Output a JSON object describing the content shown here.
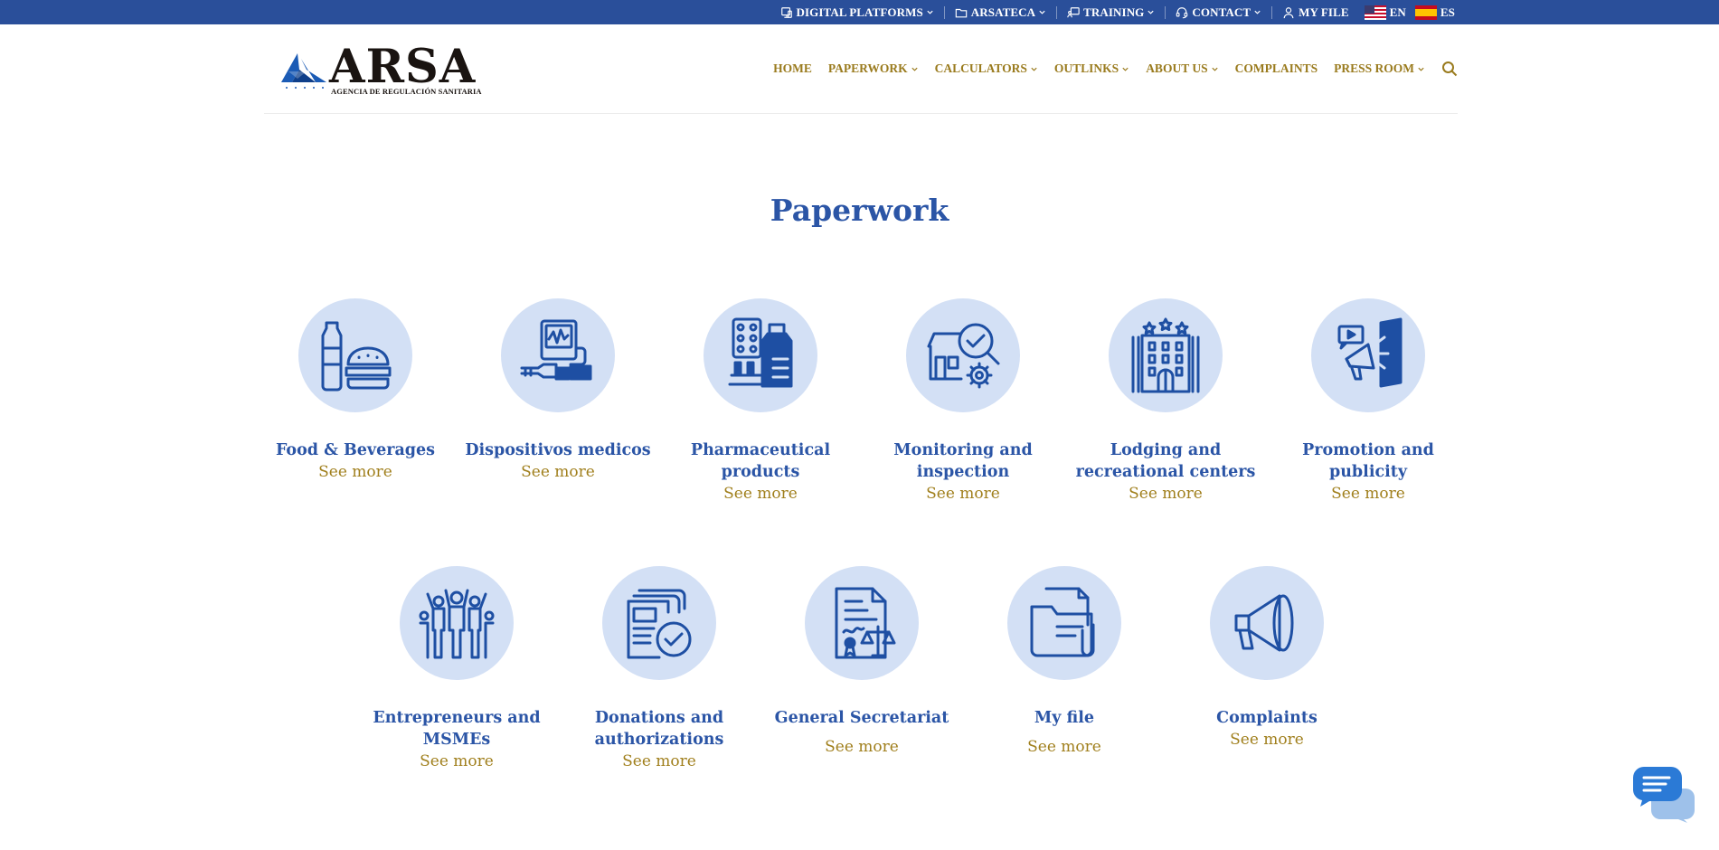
{
  "topbar": {
    "items": [
      {
        "label": "DIGITAL PLATFORMS"
      },
      {
        "label": "ARSATECA"
      },
      {
        "label": "TRAINING"
      },
      {
        "label": "CONTACT"
      },
      {
        "label": "MY FILE"
      }
    ],
    "lang_en": "EN",
    "lang_es": "ES"
  },
  "logo": {
    "word": "ARSA",
    "subtitle": "AGENCIA DE REGULACIÓN SANITARIA"
  },
  "nav": {
    "items": [
      {
        "label": "HOME"
      },
      {
        "label": "PAPERWORK"
      },
      {
        "label": "CALCULATORS"
      },
      {
        "label": "OUTLINKS"
      },
      {
        "label": "ABOUT US"
      },
      {
        "label": "COMPLAINTS"
      },
      {
        "label": "PRESS ROOM"
      }
    ]
  },
  "page": {
    "title": "Paperwork"
  },
  "cards": [
    {
      "title": "Food & Beverages",
      "more": "See more",
      "icon": "food-beverages-icon"
    },
    {
      "title": "Dispositivos medicos",
      "more": "See more",
      "icon": "medical-devices-icon"
    },
    {
      "title": "Pharmaceutical products",
      "more": "See more",
      "icon": "pharmaceutical-icon"
    },
    {
      "title": "Monitoring and inspection",
      "more": "See more",
      "icon": "inspection-icon"
    },
    {
      "title": "Lodging and recreational centers",
      "more": "See more",
      "icon": "hotel-icon"
    },
    {
      "title": "Promotion and publicity",
      "more": "See more",
      "icon": "megaphone-ad-icon"
    },
    {
      "title": "Entrepreneurs and MSMEs",
      "more": "See more",
      "icon": "people-icon"
    },
    {
      "title": "Donations and authorizations",
      "more": "See more",
      "icon": "document-check-icon"
    },
    {
      "title": "General Secretariat",
      "more": "See more",
      "icon": "legal-document-icon"
    },
    {
      "title": "My file",
      "more": "See more",
      "icon": "folder-icon"
    },
    {
      "title": "Complaints",
      "more": "See more",
      "icon": "megaphone-icon"
    }
  ],
  "colors": {
    "topbar": "#2a4f9a",
    "accent_blue": "#2b55a6",
    "gold": "#9a7b1e",
    "circle_bg": "#d3e0f5"
  }
}
